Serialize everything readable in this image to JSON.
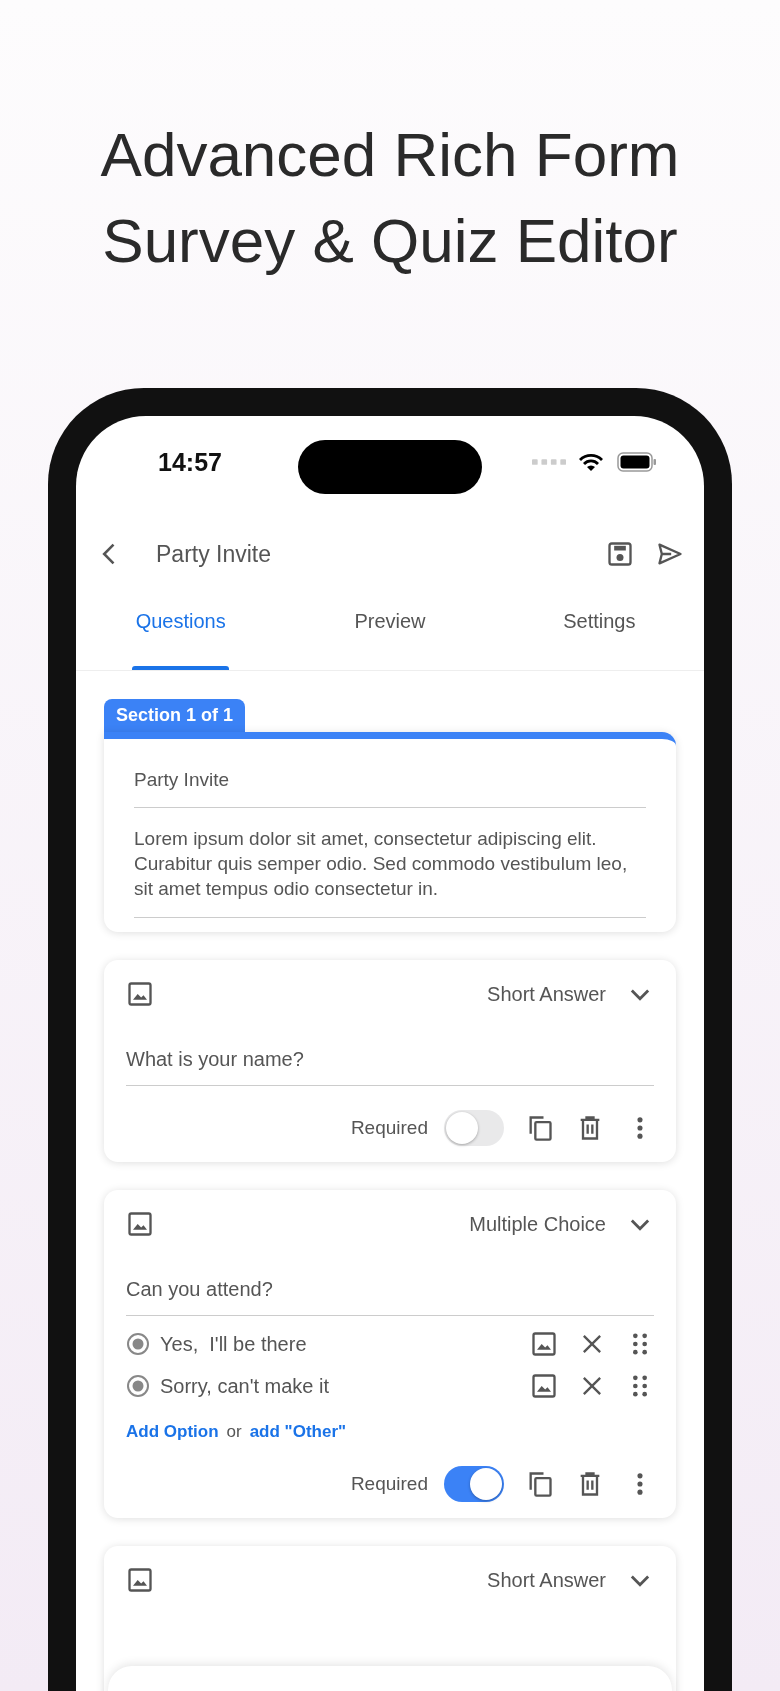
{
  "headline": [
    "Advanced Rich Form",
    "Survey & Quiz Editor"
  ],
  "status_bar": {
    "time": "14:57"
  },
  "header": {
    "title": "Party Invite"
  },
  "tabs": [
    {
      "label": "Questions",
      "selected": true
    },
    {
      "label": "Preview",
      "selected": false
    },
    {
      "label": "Settings",
      "selected": false
    }
  ],
  "section": {
    "tag": "Section 1 of 1",
    "title": "Party Invite",
    "description": "Lorem ipsum dolor sit amet, consectetur adipiscing elit. Curabitur quis semper odio. Sed commodo vestibulum leo, sit amet tempus odio consectetur in."
  },
  "questions": [
    {
      "type": "Short Answer",
      "question": "What is your name?",
      "required_label": "Required",
      "required": false
    },
    {
      "type": "Multiple Choice",
      "question": "Can you attend?",
      "options": [
        "Yes,  I'll be there",
        "Sorry, can't make it"
      ],
      "add_option": "Add Option",
      "or": "or",
      "add_other": "add \"Other\"",
      "required_label": "Required",
      "required": true
    },
    {
      "type": "Short Answer"
    }
  ]
}
